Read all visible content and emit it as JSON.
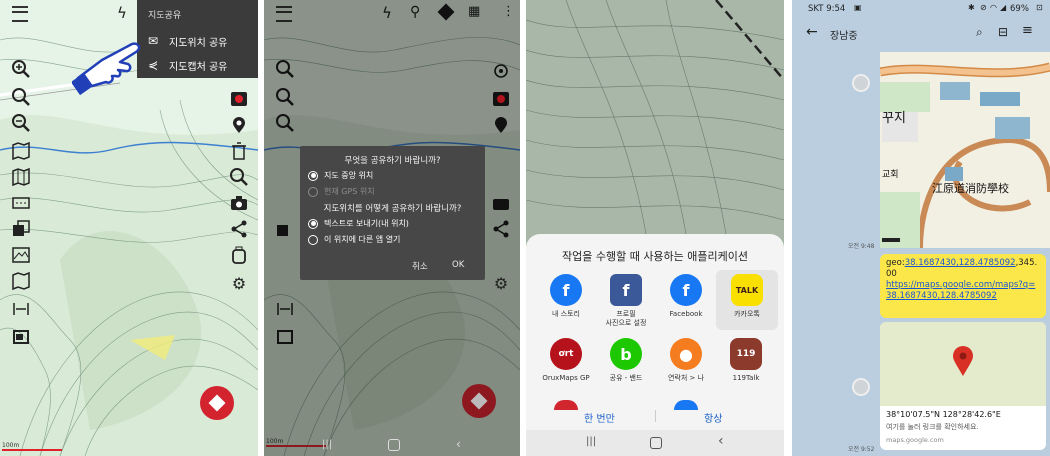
{
  "panel1": {
    "menu_header": "지도공유",
    "menu_items": [
      {
        "label": "지도위치 공유",
        "icon": "share-location-icon"
      },
      {
        "label": "지도캡처 공유",
        "icon": "share-icon"
      }
    ],
    "scale_label": "100m",
    "colors": {
      "menu_bg": "#3b3b3b",
      "map_bg": "#e3f2e6",
      "fab": "#d3232e"
    }
  },
  "panel2": {
    "question1": "무엇을 공유하기 바랍니까?",
    "options1": [
      {
        "label": "지도 중앙 위치",
        "selected": true,
        "enabled": true
      },
      {
        "label": "현재 GPS 위치",
        "selected": false,
        "enabled": false
      }
    ],
    "question2": "지도위치를 어떻게 공유하기 바랍니까?",
    "options2": [
      {
        "label": "텍스트로 보내기(내 위치)",
        "selected": true
      },
      {
        "label": "이 위치에 다른 앱 열기",
        "selected": false
      }
    ],
    "cancel": "취소",
    "ok": "OK",
    "scale_label": "100m"
  },
  "panel3": {
    "sheet_title": "작업을 수행할 때 사용하는 애플리케이션",
    "apps": [
      {
        "label": "내 스토리",
        "icon": "facebook-icon",
        "color": "#1877f2"
      },
      {
        "label": "프로필\n사진으로 설정",
        "icon": "facebook-profile-icon",
        "color": "#3b5998"
      },
      {
        "label": "Facebook",
        "icon": "facebook-icon",
        "color": "#1877f2"
      },
      {
        "label": "카카오톡",
        "icon": "kakaotalk-icon",
        "color": "#f9e000"
      },
      {
        "label": "OruxMaps GP",
        "icon": "oruxmaps-icon",
        "color": "#b5121b"
      },
      {
        "label": "공유 - 밴드",
        "icon": "band-icon",
        "color": "#1ec800"
      },
      {
        "label": "연락처 > 나",
        "icon": "contacts-icon",
        "color": "#f57c1f"
      },
      {
        "label": "119Talk",
        "icon": "119talk-icon",
        "color": "#8b3a2b"
      }
    ],
    "just_once": "한 번만",
    "always": "항상"
  },
  "panel4": {
    "status": {
      "carrier_time": "SKT 9:54",
      "battery": "69%"
    },
    "chat_title": "장남중",
    "map_labels": {
      "l1": "꾸지",
      "l2": "교회",
      "l3": "江原道消防學校"
    },
    "time1": "오전 9:48",
    "time2": "오전 9:52",
    "geo_prefix": "geo:",
    "geo_link": "38.1687430,128.4785092",
    "geo_suffix": ",345.00",
    "maps_link": "https://maps.google.com/maps?q=38.1687430,128.4785092",
    "coords": "38°10'07.5\"N 128°28'42.6\"E",
    "hint": "여기를 눌러 링크를 확인하세요.",
    "domain": "maps.google.com",
    "colors": {
      "chat_bg": "#bacee0",
      "bubble_yellow": "#fbe74a",
      "link": "#1a55d0"
    }
  }
}
